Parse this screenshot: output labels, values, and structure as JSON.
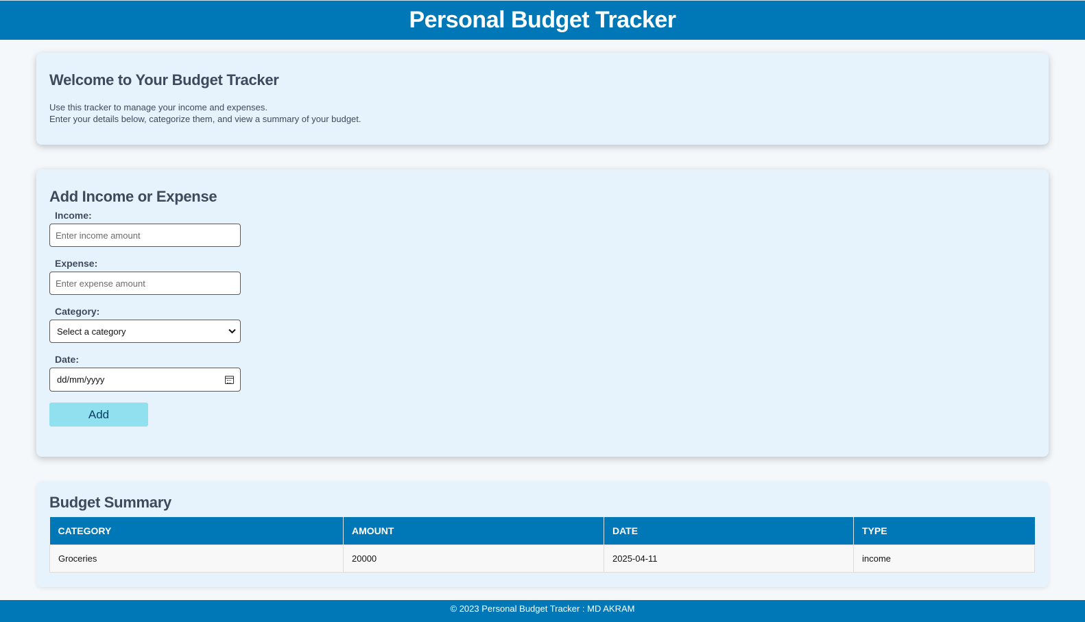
{
  "header": {
    "title": "Personal Budget Tracker"
  },
  "welcome": {
    "title": "Welcome to Your Budget Tracker",
    "line1": "Use this tracker to manage your income and expenses.",
    "line2": "Enter your details below, categorize them, and view a summary of your budget."
  },
  "form": {
    "title": "Add Income or Expense",
    "income_label": "Income:",
    "income_placeholder": "Enter income amount",
    "expense_label": "Expense:",
    "expense_placeholder": "Enter expense amount",
    "category_label": "Category:",
    "category_selected": "Select a category",
    "date_label": "Date:",
    "date_value": "dd/mm/yyyy",
    "add_label": "Add",
    "icons": {
      "select": "chevron-down-icon",
      "date": "calendar-icon"
    }
  },
  "summary": {
    "title": "Budget Summary",
    "columns": [
      "CATEGORY",
      "AMOUNT",
      "DATE",
      "TYPE"
    ],
    "rows": [
      {
        "category": "Groceries",
        "amount": "20000",
        "date": "2025-04-11",
        "type": "income"
      }
    ]
  },
  "footer": {
    "text": "© 2023 Personal Budget Tracker : MD AKRAM"
  },
  "colors": {
    "primary": "#0077b6",
    "card": "#e6f3fd",
    "button": "#90e0ef"
  }
}
